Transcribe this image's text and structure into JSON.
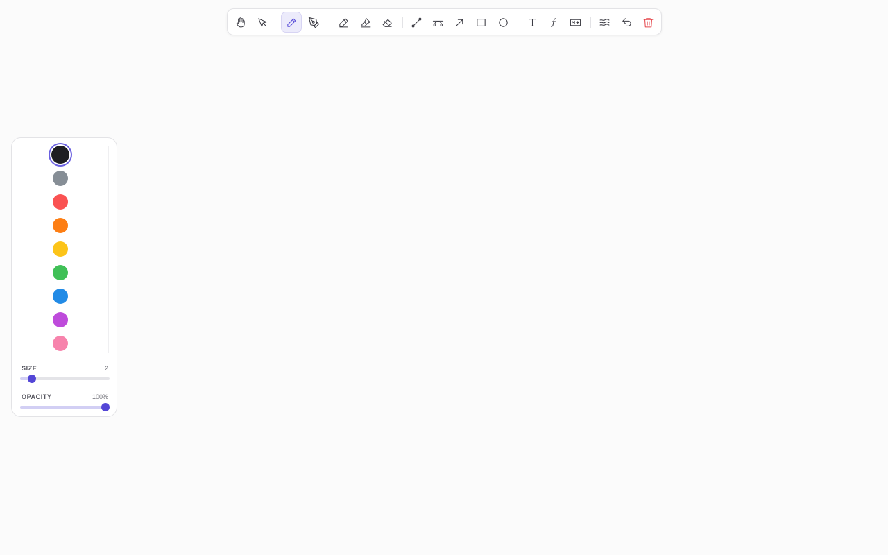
{
  "toolbar": {
    "tools": [
      {
        "name": "hand-icon",
        "active": false
      },
      {
        "name": "select-arrow-icon",
        "active": false
      },
      {
        "name": "pencil-icon",
        "active": true
      },
      {
        "name": "pen-nib-icon",
        "active": false
      },
      {
        "name": "marker-icon",
        "active": false
      },
      {
        "name": "highlighter-icon",
        "active": false
      },
      {
        "name": "eraser-icon",
        "active": false
      },
      {
        "name": "line-icon",
        "active": false
      },
      {
        "name": "curve-icon",
        "active": false
      },
      {
        "name": "arrow-icon",
        "active": false
      },
      {
        "name": "rectangle-icon",
        "active": false
      },
      {
        "name": "circle-icon",
        "active": false
      },
      {
        "name": "text-icon",
        "active": false
      },
      {
        "name": "function-icon",
        "active": false
      },
      {
        "name": "markdown-icon",
        "active": false
      },
      {
        "name": "wave-icon",
        "active": false
      },
      {
        "name": "undo-icon",
        "active": false
      },
      {
        "name": "trash-icon",
        "active": false
      }
    ],
    "markdown_badge": "M+"
  },
  "panel": {
    "colors": [
      "#1e1e22",
      "#868e96",
      "#fa5252",
      "#fd7e14",
      "#fcc419",
      "#40c057",
      "#228be6",
      "#be4bdb",
      "#f783ac"
    ],
    "selected_color": "#1e1e22",
    "size": {
      "label": "SIZE",
      "value": "2",
      "level": 0.09
    },
    "opacity": {
      "label": "OPACITY",
      "value": "100%",
      "level": 1.0
    }
  },
  "colors": {
    "accent": "#5346d6",
    "danger": "#e5484d"
  }
}
